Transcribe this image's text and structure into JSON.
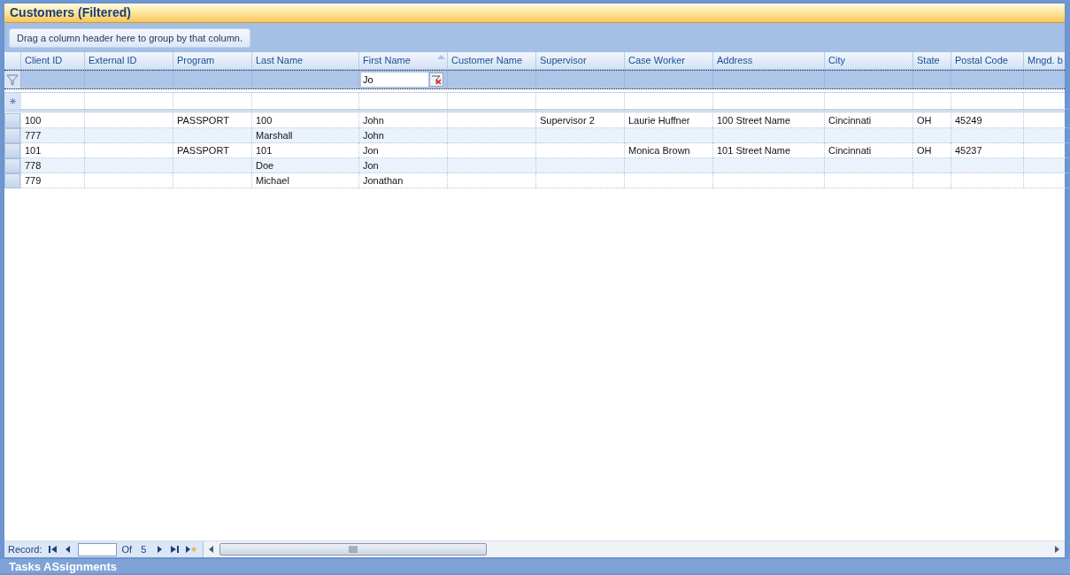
{
  "panel": {
    "title": "Customers (Filtered)"
  },
  "group_panel": {
    "hint": "Drag a column header here to group by that column."
  },
  "table": {
    "columns": [
      {
        "label": "Client ID",
        "sorted": false
      },
      {
        "label": "External ID",
        "sorted": false
      },
      {
        "label": "Program",
        "sorted": false
      },
      {
        "label": "Last Name",
        "sorted": false
      },
      {
        "label": "First Name",
        "sorted": true,
        "filter": "Jo"
      },
      {
        "label": "Customer Name",
        "sorted": false
      },
      {
        "label": "Supervisor",
        "sorted": false
      },
      {
        "label": "Case Worker",
        "sorted": false
      },
      {
        "label": "Address",
        "sorted": false
      },
      {
        "label": "City",
        "sorted": false
      },
      {
        "label": "State",
        "sorted": false
      },
      {
        "label": "Postal Code",
        "sorted": false
      },
      {
        "label": "Mngd. b",
        "sorted": false
      }
    ],
    "rows": [
      [
        "100",
        "",
        "PASSPORT",
        "100",
        "John",
        "",
        "Supervisor 2",
        "Laurie Huffner",
        "100 Street Name",
        "Cincinnati",
        "OH",
        "45249",
        ""
      ],
      [
        "777",
        "",
        "",
        "Marshall",
        "John",
        "",
        "",
        "",
        "",
        "",
        "",
        "",
        ""
      ],
      [
        "101",
        "",
        "PASSPORT",
        "101",
        "Jon",
        "",
        "",
        "Monica Brown",
        "101 Street Name",
        "Cincinnati",
        "OH",
        "45237",
        ""
      ],
      [
        "778",
        "",
        "",
        "Doe",
        "Jon",
        "",
        "",
        "",
        "",
        "",
        "",
        "",
        ""
      ],
      [
        "779",
        "",
        "",
        "Michael",
        "Jonathan",
        "",
        "",
        "",
        "",
        "",
        "",
        "",
        ""
      ]
    ]
  },
  "navigator": {
    "label": "Record:",
    "of": "Of",
    "total": "5"
  },
  "next_panel": {
    "title": "Tasks ASsignments"
  }
}
